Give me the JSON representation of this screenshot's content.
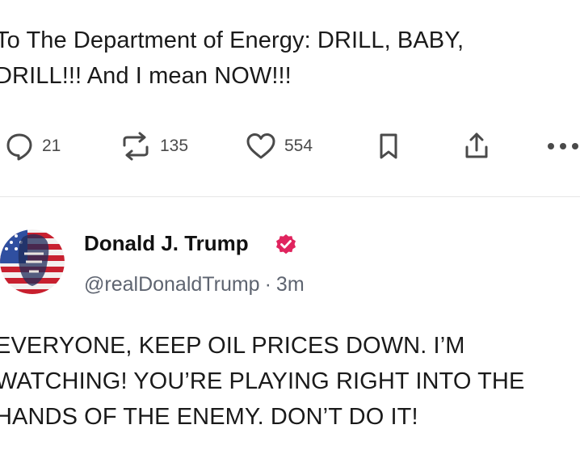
{
  "posts": {
    "top": {
      "text": "To The Department of Energy: DRILL, BABY,\nDRILL!!!  And I mean NOW!!!",
      "replies": "21",
      "reposts": "135",
      "likes": "554"
    },
    "bottom": {
      "author_name": "Donald J. Trump",
      "handle": "@realDonaldTrump",
      "separator": "·",
      "time": "3m",
      "text": "EVERYONE, KEEP OIL PRICES DOWN. I’M\nWATCHING! YOU’RE PLAYING RIGHT INTO THE\nHANDS OF THE ENEMY. DON’T DO IT!",
      "verified": true
    }
  },
  "icons": {
    "reply": "speech-bubble-icon",
    "repost": "repost-arrows-icon",
    "like": "heart-icon",
    "bookmark": "bookmark-icon",
    "share": "share-upload-icon",
    "more": "more-dots-icon",
    "verified": "verified-badge-icon"
  },
  "colors": {
    "verified_badge": "#e0245e",
    "icon_gray": "#4a4a4a",
    "handle_gray": "#5e6470"
  }
}
